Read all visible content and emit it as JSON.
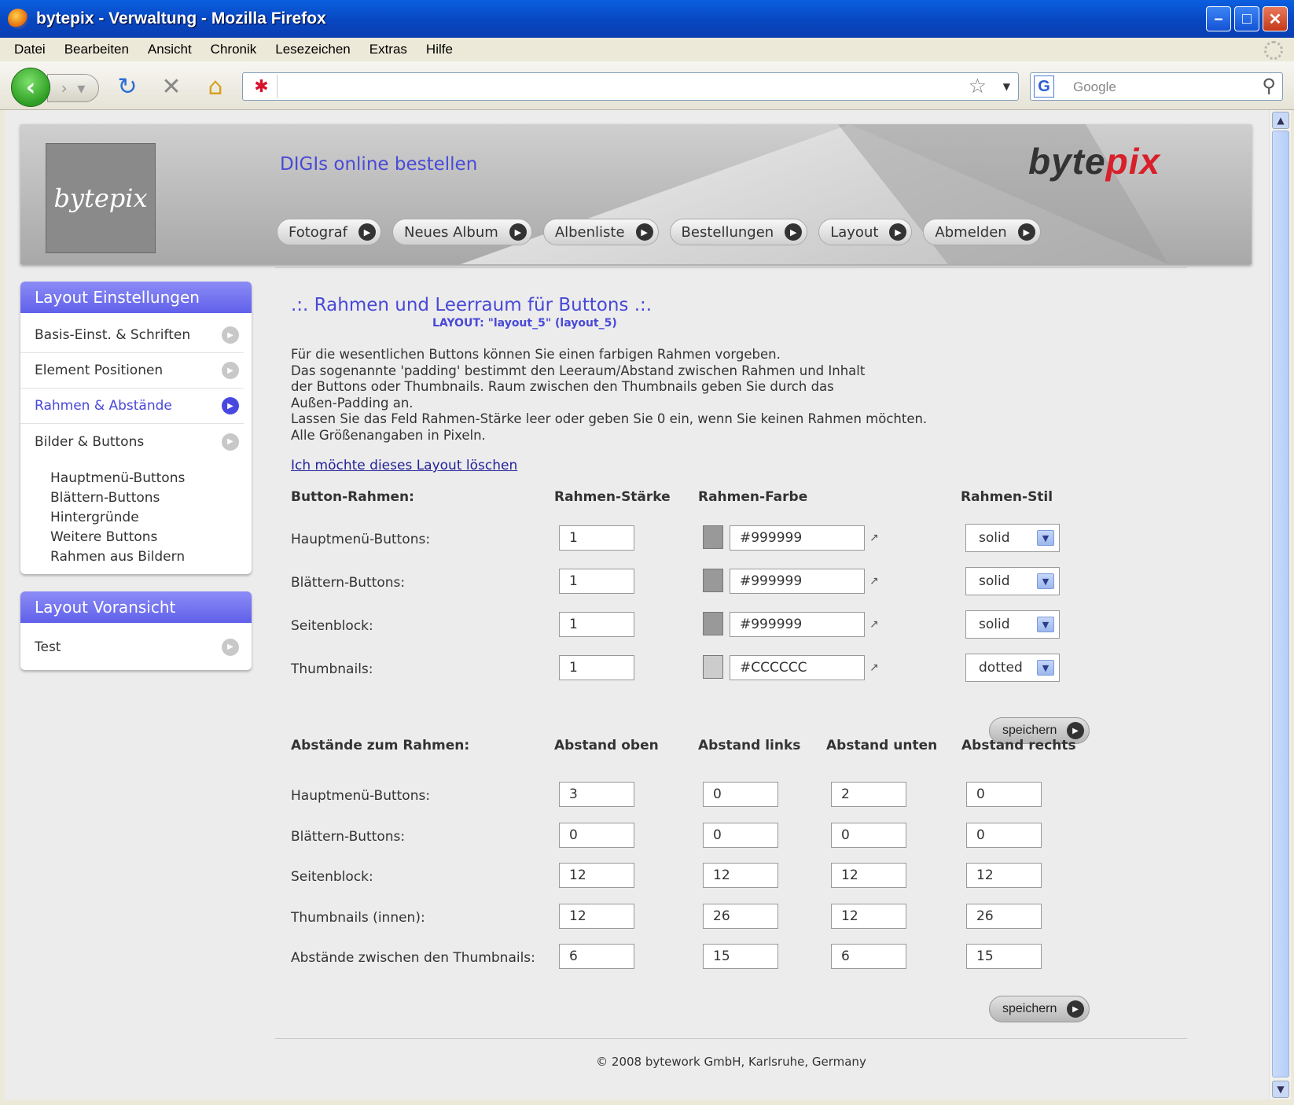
{
  "window": {
    "title": "bytepix - Verwaltung - Mozilla Firefox"
  },
  "menu": [
    "Datei",
    "Bearbeiten",
    "Ansicht",
    "Chronik",
    "Lesezeichen",
    "Extras",
    "Hilfe"
  ],
  "search": {
    "placeholder": "Google"
  },
  "header": {
    "logo_text": "bytepix",
    "brand_left": "byte",
    "brand_right": "pix",
    "tagline": "DIGIs online bestellen",
    "nav": [
      "Fotograf",
      "Neues Album",
      "Albenliste",
      "Bestellungen",
      "Layout",
      "Abmelden"
    ]
  },
  "sidebar": {
    "settings_title": "Layout Einstellungen",
    "settings_items": [
      "Basis-Einst. & Schriften",
      "Element Positionen",
      "Rahmen & Abstände",
      "Bilder & Buttons"
    ],
    "sub_items": [
      "Hauptmenü-Buttons",
      "Blättern-Buttons",
      "Hintergründe",
      "Weitere Buttons",
      "Rahmen aus Bildern"
    ],
    "preview_title": "Layout Voransicht",
    "preview_items": [
      "Test"
    ]
  },
  "main": {
    "title": ".:. Rahmen und Leerraum für Buttons .:.",
    "subtitle": "LAYOUT: \"layout_5\" (layout_5)",
    "description": "Für die wesentlichen Buttons können Sie einen farbigen Rahmen vorgeben.\nDas sogenannte 'padding' bestimmt den Leeraum/Abstand zwischen Rahmen und Inhalt\nder Buttons oder Thumbnails. Raum zwischen den Thumbnails geben Sie durch das\nAußen-Padding an.\nLassen Sie das Feld Rahmen-Stärke leer oder geben Sie 0 ein, wenn Sie keinen Rahmen möchten.\nAlle Größenangaben in Pixeln.",
    "delete_link": "Ich möchte dieses Layout löschen",
    "border_headers": [
      "Button-Rahmen:",
      "Rahmen-Stärke",
      "Rahmen-Farbe",
      "Rahmen-Stil"
    ],
    "border_rows": [
      {
        "label": "Hauptmenü-Buttons:",
        "width": "1",
        "color": "#999999",
        "swatch": "#999999",
        "style": "solid"
      },
      {
        "label": "Blättern-Buttons:",
        "width": "1",
        "color": "#999999",
        "swatch": "#999999",
        "style": "solid"
      },
      {
        "label": "Seitenblock:",
        "width": "1",
        "color": "#999999",
        "swatch": "#999999",
        "style": "solid"
      },
      {
        "label": "Thumbnails:",
        "width": "1",
        "color": "#CCCCCC",
        "swatch": "#CCCCCC",
        "style": "dotted"
      }
    ],
    "save_label": "speichern",
    "padding_headers": [
      "Abstände zum Rahmen:",
      "Abstand oben",
      "Abstand links",
      "Abstand unten",
      "Abstand rechts"
    ],
    "padding_rows": [
      {
        "label": "Hauptmenü-Buttons:",
        "values": [
          "3",
          "0",
          "2",
          "0"
        ]
      },
      {
        "label": "Blättern-Buttons:",
        "values": [
          "0",
          "0",
          "0",
          "0"
        ]
      },
      {
        "label": "Seitenblock:",
        "values": [
          "12",
          "12",
          "12",
          "12"
        ]
      },
      {
        "label": "Thumbnails (innen):",
        "values": [
          "12",
          "26",
          "12",
          "26"
        ]
      },
      {
        "label": "Abstände zwischen den Thumbnails:",
        "values": [
          "6",
          "15",
          "6",
          "15"
        ]
      }
    ]
  },
  "footer": "© 2008 bytework GmbH, Karlsruhe, Germany"
}
